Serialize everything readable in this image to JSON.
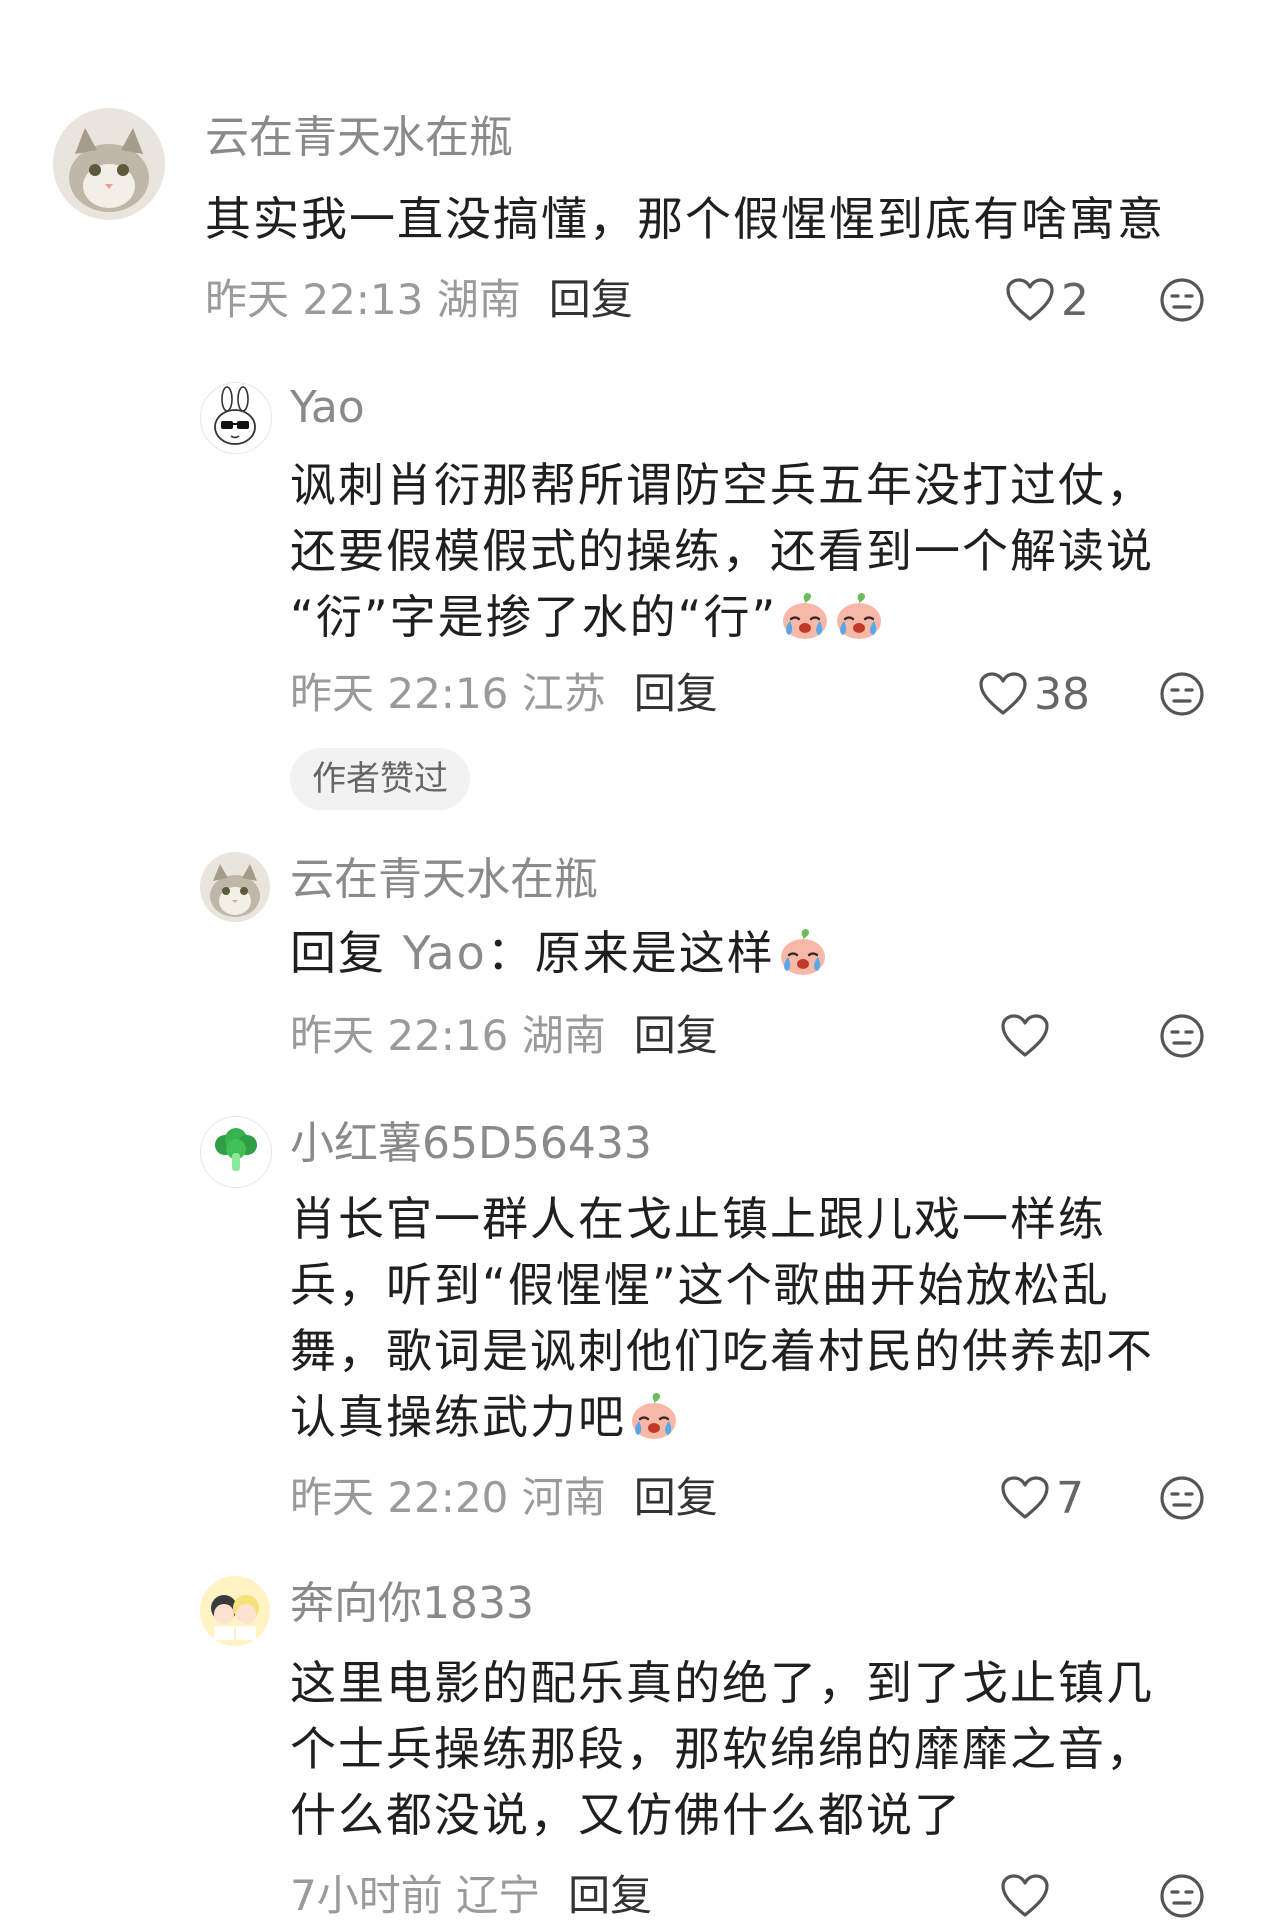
{
  "comments": [
    {
      "username": "云在青天水在瓶",
      "text": "其实我一直没搞懂，那个假惺惺到底有啥寓意",
      "meta": "昨天 22:13 湖南",
      "reply_label": "回复",
      "likes": "2"
    },
    {
      "username": "Yao",
      "text_lines": [
        "讽刺肖衍那帮所谓防空兵五年没打过仗，",
        "还要假模假式的操练，还看到一个解读说",
        "“衍”字是掺了水的“行”"
      ],
      "meta": "昨天 22:16 江苏",
      "reply_label": "回复",
      "likes": "38",
      "badge": "作者赞过"
    },
    {
      "username": "云在青天水在瓶",
      "reply_prefix": "回复",
      "reply_to": "Yao",
      "text": "：原来是这样",
      "meta": "昨天 22:16 湖南",
      "reply_label": "回复",
      "likes": ""
    },
    {
      "username": "小红薯65D56433",
      "text_lines": [
        "肖长官一群人在戈止镇上跟儿戏一样练",
        "兵，听到“假惺惺”这个歌曲开始放松乱",
        "舞，歌词是讽刺他们吃着村民的供养却不",
        "认真操练武力吧"
      ],
      "meta": "昨天 22:20 河南",
      "reply_label": "回复",
      "likes": "7"
    },
    {
      "username": "奔向你1833",
      "text_lines": [
        "这里电影的配乐真的绝了，到了戈止镇几",
        "个士兵操练那段，那软绵绵的靡靡之音，",
        "什么都没说，又仿佛什么都说了"
      ],
      "meta": "7小时前 辽宁",
      "reply_label": "回复"
    }
  ],
  "icons": {
    "like": "heart-outline-icon",
    "dislike": "neutral-face-icon",
    "emoji": "crying-peach-emoji"
  }
}
